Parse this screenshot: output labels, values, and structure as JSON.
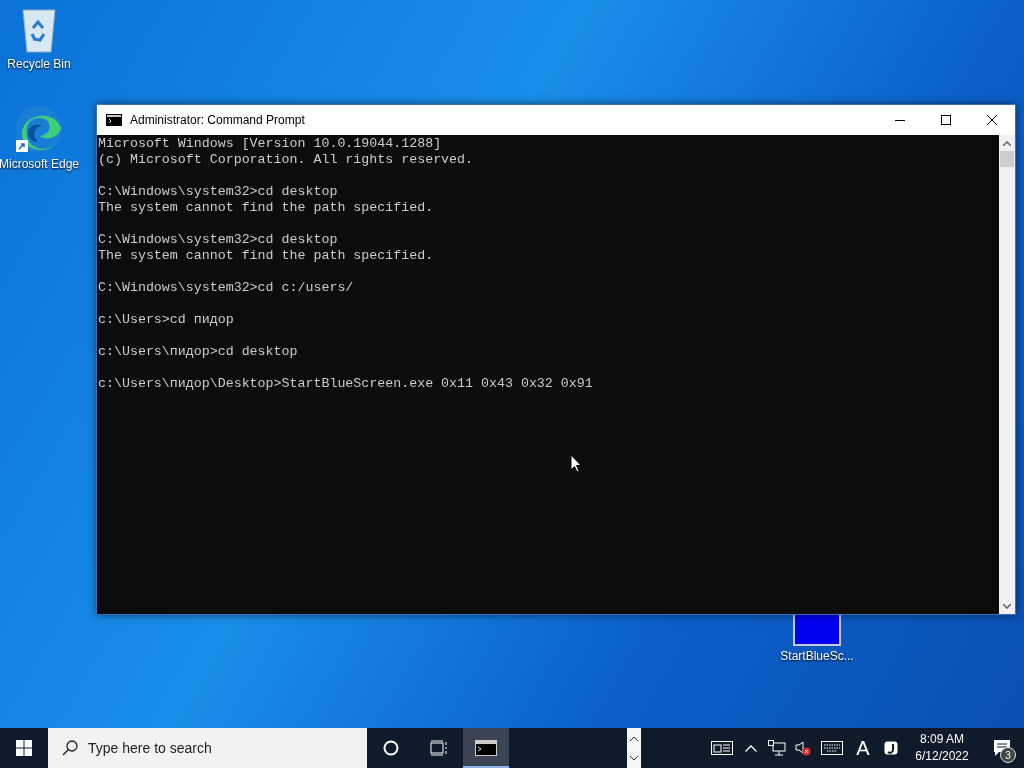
{
  "desktop_icons": [
    {
      "kind": "recycle",
      "label": "Recycle Bin"
    },
    {
      "kind": "edge",
      "label": "Microsoft Edge"
    },
    {
      "kind": "file",
      "label": "StartBlueSc..."
    }
  ],
  "window": {
    "title": "Administrator: Command Prompt",
    "console_blocks": [
      [
        "Microsoft Windows [Version 10.0.19044.1288]",
        "(c) Microsoft Corporation. All rights reserved."
      ],
      [
        "C:\\Windows\\system32>cd desktop",
        "The system cannot find the path specified."
      ],
      [
        "C:\\Windows\\system32>cd desktop",
        "The system cannot find the path specified."
      ],
      [
        "C:\\Windows\\system32>cd c:/users/"
      ],
      [
        "c:\\Users>cd пидор"
      ],
      [
        "c:\\Users\\пидор>cd desktop"
      ],
      [
        "c:\\Users\\пидор\\Desktop>StartBlueScreen.exe 0x11 0x43 0x32 0x91"
      ]
    ]
  },
  "taskbar": {
    "search": {
      "placeholder": "Type here to search"
    },
    "apps": [
      {
        "kind": "cmd",
        "selected": true
      }
    ],
    "input_language": "A",
    "time": "8:09 AM",
    "date": "6/12/2022",
    "notification_count": "3"
  }
}
